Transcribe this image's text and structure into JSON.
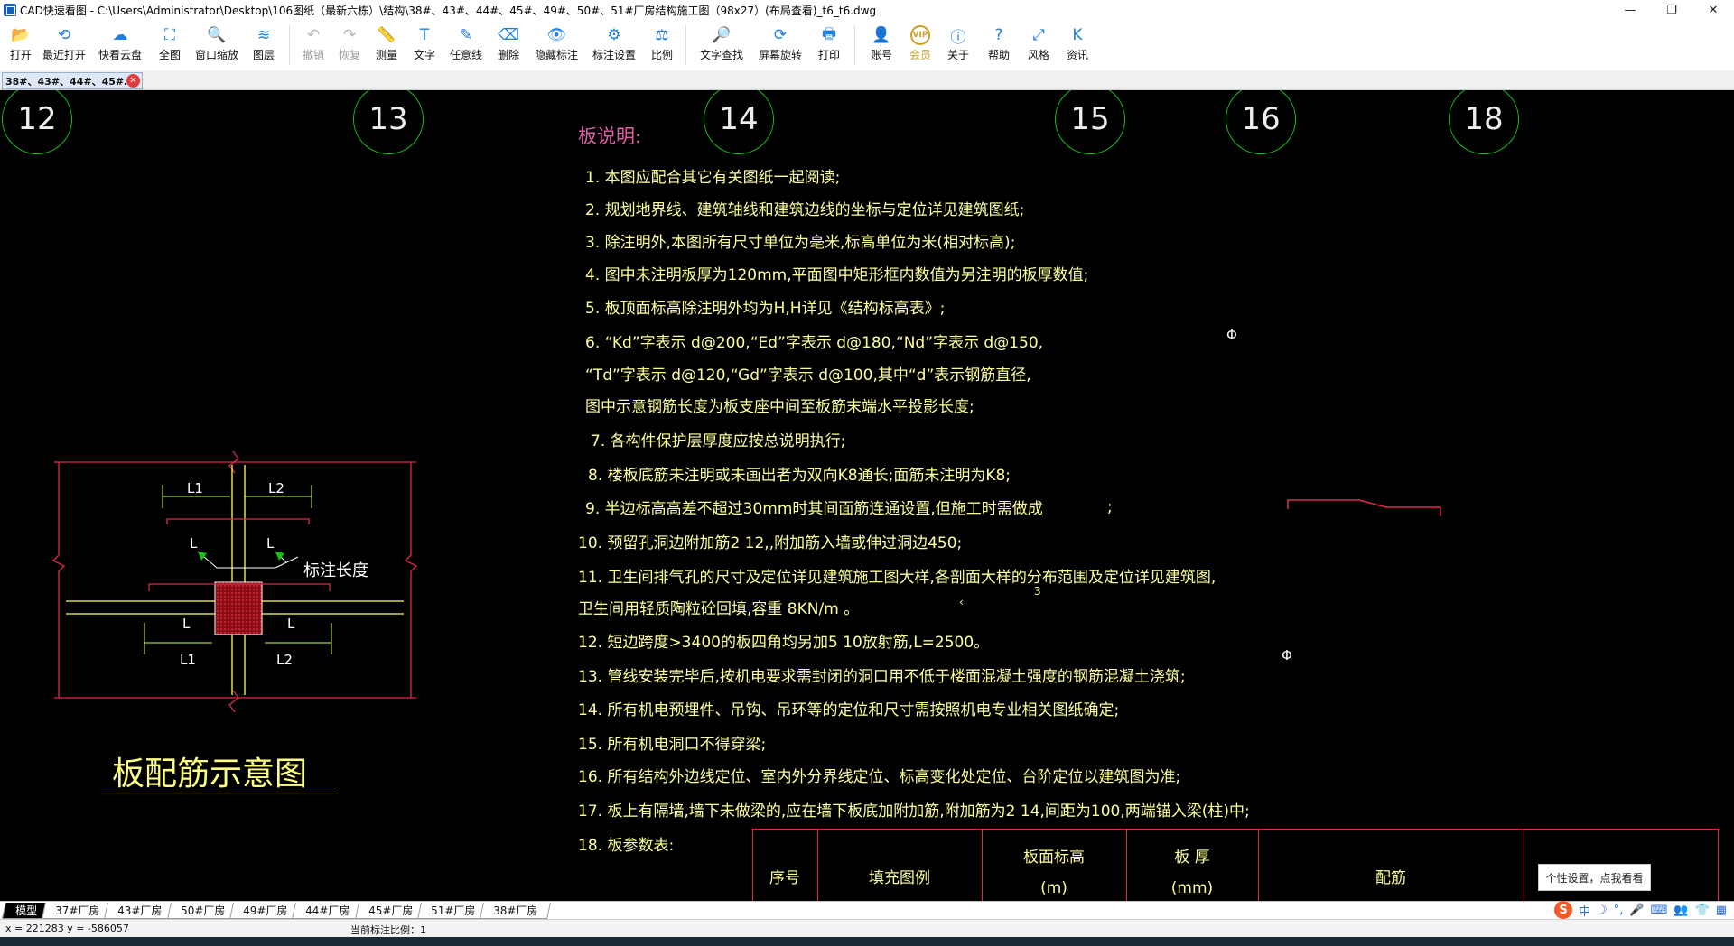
{
  "window": {
    "title": "CAD快速看图 - C:\\Users\\Administrator\\Desktop\\106图纸（最新六栋）\\结构\\38#、43#、44#、45#、49#、50#、51#厂房结构施工图（98x27）(布局查看)_t6_t6.dwg",
    "minimize": "—",
    "maximize": "❐",
    "close": "✕"
  },
  "toolbar": {
    "items": [
      {
        "label": "打开",
        "icon": "folder-icon",
        "glyph": "📂"
      },
      {
        "label": "最近打开",
        "icon": "clock-icon",
        "glyph": "⟲"
      },
      {
        "label": "快看云盘",
        "icon": "cloud-icon",
        "glyph": "☁"
      },
      {
        "label": "全图",
        "icon": "fullview-icon",
        "glyph": "⛶"
      },
      {
        "label": "窗口缩放",
        "icon": "zoom-window-icon",
        "glyph": "🔍"
      },
      {
        "label": "图层",
        "icon": "layers-icon",
        "glyph": "≋"
      },
      {
        "label": "撤销",
        "icon": "undo-icon",
        "glyph": "↶"
      },
      {
        "label": "恢复",
        "icon": "redo-icon",
        "glyph": "↷"
      },
      {
        "label": "测量",
        "icon": "ruler-icon",
        "glyph": "📏"
      },
      {
        "label": "文字",
        "icon": "text-icon",
        "glyph": "T"
      },
      {
        "label": "任意线",
        "icon": "pen-icon",
        "glyph": "✎"
      },
      {
        "label": "删除",
        "icon": "eraser-icon",
        "glyph": "⌫"
      },
      {
        "label": "隐藏标注",
        "icon": "eye-icon",
        "glyph": "👁"
      },
      {
        "label": "标注设置",
        "icon": "annotation-settings-icon",
        "glyph": "⚙"
      },
      {
        "label": "比例",
        "icon": "scale-icon",
        "glyph": "⚖"
      },
      {
        "label": "文字查找",
        "icon": "text-search-icon",
        "glyph": "🔎"
      },
      {
        "label": "屏幕旋转",
        "icon": "rotate-icon",
        "glyph": "⟳"
      },
      {
        "label": "打印",
        "icon": "printer-icon",
        "glyph": "🖶"
      },
      {
        "label": "账号",
        "icon": "user-icon",
        "glyph": "👤"
      },
      {
        "label": "会员",
        "icon": "vip-icon",
        "glyph": "VIP"
      },
      {
        "label": "关于",
        "icon": "info-icon",
        "glyph": "ⓘ"
      },
      {
        "label": "帮助",
        "icon": "help-icon",
        "glyph": "?"
      },
      {
        "label": "风格",
        "icon": "style-icon",
        "glyph": "⤢"
      },
      {
        "label": "资讯",
        "icon": "news-icon",
        "glyph": "K"
      }
    ]
  },
  "doc_tab": {
    "label": "38#、43#、44#、45#…",
    "close": "✕"
  },
  "drawing": {
    "axes": [
      "12",
      "13",
      "14",
      "15",
      "16",
      "18"
    ],
    "notes_title": "板说明:",
    "notes": [
      "1.  本图应配合其它有关图纸一起阅读;",
      "2.  规划地界线、建筑轴线和建筑边线的坐标与定位详见建筑图纸;",
      "3.  除注明外,本图所有尺寸单位为毫米,标高单位为米(相对标高);",
      "4.  图中未注明板厚为120mm,平面图中矩形框内数值为另注明的板厚数值;",
      "5.  板顶面标高除注明外均为H,H详见《结构标高表》;",
      "6.  “Kd”字表示 d@200,“Ed”字表示 d@180,“Nd”字表示 d@150,",
      "     “Td”字表示 d@120,“Gd”字表示 d@100,其中“d”表示钢筋直径,",
      "     图中示意钢筋长度为板支座中间至板筋末端水平投影长度;",
      "7.  各构件保护层厚度应按总说明执行;",
      "8.  楼板底筋未注明或未画出者为双向K8通长;面筋未注明为K8;",
      "9.  半边标高高差不超过30mm时其间面筋连通设置,但施工时需做成",
      "10.  预留孔洞边附加筋2  12,,附加筋入墙或伸过洞边450;",
      "11.  卫生间排气孔的尺寸及定位详见建筑施工图大样,各剖面大样的分布范围及定位详见建筑图,",
      "       卫生间用轻质陶粒砼回填,容重 8KN/m  。",
      "12.  短边跨度>3400的板四角均另加5    10放射筋,L=2500。",
      "13.  管线安装完毕后,按机电要求需封闭的洞口用不低于楼面混凝土强度的钢筋混凝土浇筑;",
      "14.  所有机电预埋件、吊钩、吊环等的定位和尺寸需按照机电专业相关图纸确定;",
      "15.  所有机电洞口不得穿梁;",
      "16.  所有结构外边线定位、室内外分界线定位、标高变化处定位、台阶定位以建筑图为准;",
      "17.  板上有隔墙,墙下未做梁的,应在墙下板底加附加筋,附加筋为2  14,间距为100,两端锚入梁(柱)中;",
      "18.  板参数表:"
    ],
    "note9_tail": ";",
    "note11_sup": "3",
    "note11_mark": "‹",
    "diagram": {
      "title": "板配筋示意图",
      "callout": "标注长度",
      "dims": [
        "L1",
        "L2",
        "L",
        "L",
        "L",
        "L",
        "L1",
        "L2"
      ]
    },
    "table_headers": [
      {
        "line1": "序号",
        "line2": ""
      },
      {
        "line1": "填充图例",
        "line2": ""
      },
      {
        "line1": "板面标高",
        "line2": "(m)"
      },
      {
        "line1": "板  厚",
        "line2": "(mm)"
      },
      {
        "line1": "配筋",
        "line2": ""
      }
    ],
    "tooltip": "个性设置，点我看看"
  },
  "layout_tabs": [
    "模型",
    "37#厂房",
    "43#厂房",
    "50#厂房",
    "49#厂房",
    "44#厂房",
    "45#厂房",
    "51#厂房",
    "38#厂房"
  ],
  "ime": {
    "logo": "S",
    "lang": "中",
    "moon": "☽",
    "dot": "°,",
    "mic": "🎤",
    "kbd": "⌨",
    "person": "👥",
    "shirt": "👕",
    "grid": "▦"
  },
  "status": {
    "coords": "x = 221283  y = -586057",
    "scale": "当前标注比例：1"
  },
  "colors": {
    "canvas": "#000000",
    "axis_circle": "#19c219",
    "note_text": "#ffff9a",
    "title_magenta": "#e060a8",
    "red_line": "#e02a4a",
    "yellow_line": "#ffff60"
  }
}
